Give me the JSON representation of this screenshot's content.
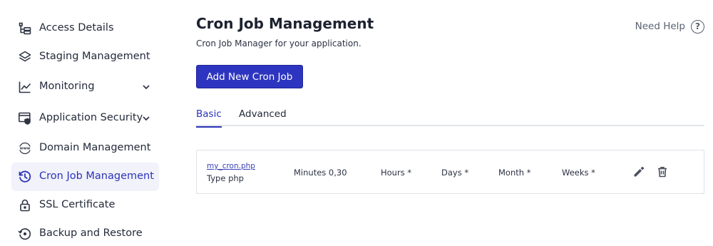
{
  "sidebar": {
    "items": [
      {
        "label": "Access Details",
        "icon": "access-details-icon"
      },
      {
        "label": "Staging Management",
        "icon": "layers-icon"
      },
      {
        "label": "Monitoring",
        "icon": "line-chart-icon",
        "expandable": true
      },
      {
        "label": "Application Security",
        "icon": "window-shield-icon",
        "expandable": true
      },
      {
        "label": "Domain Management",
        "icon": "www-globe-icon"
      },
      {
        "label": "Cron Job Management",
        "icon": "history-clock-icon",
        "active": true
      },
      {
        "label": "SSL Certificate",
        "icon": "lock-icon"
      },
      {
        "label": "Backup and Restore",
        "icon": "restore-icon"
      }
    ]
  },
  "header": {
    "title": "Cron Job Management",
    "subtitle": "Cron Job Manager for your application.",
    "help_label": "Need Help",
    "help_icon": "question-circle-icon"
  },
  "actions": {
    "add_label": "Add New Cron Job"
  },
  "tabs": [
    {
      "label": "Basic",
      "active": true
    },
    {
      "label": "Advanced",
      "active": false
    }
  ],
  "cron_jobs": [
    {
      "name": "my_cron.php",
      "type": "Type php",
      "minutes": "Minutes 0,30",
      "hours": "Hours *",
      "days": "Days *",
      "month": "Month *",
      "weeks": "Weeks *",
      "edit_icon": "pencil-icon",
      "delete_icon": "trash-icon"
    }
  ],
  "colors": {
    "accent": "#2d35c0",
    "active_bg": "#f1f2fa",
    "text": "#232a3a",
    "muted": "#5b6272",
    "border": "#dfe1e6"
  }
}
